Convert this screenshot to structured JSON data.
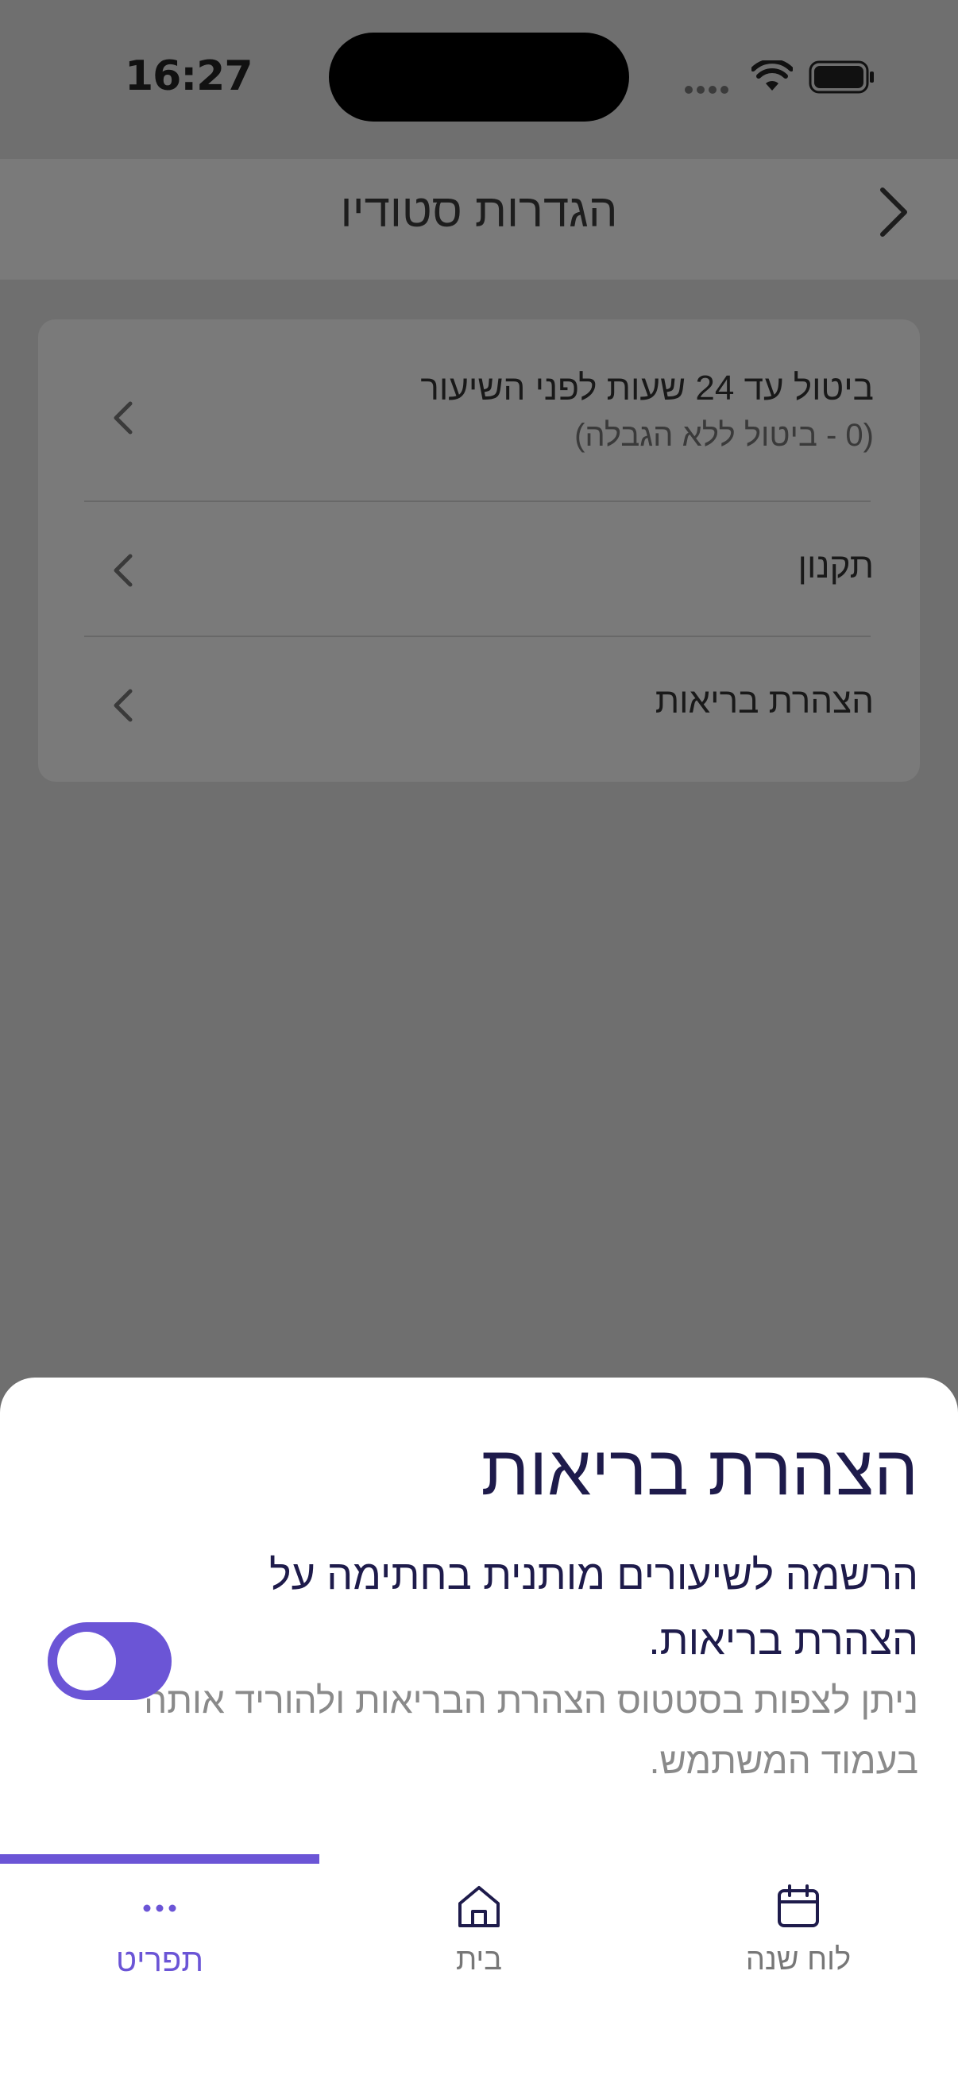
{
  "status_bar": {
    "time": "16:27"
  },
  "header": {
    "title": "הגדרות סטודיו"
  },
  "settings": {
    "items": [
      {
        "title": "ביטול עד 24 שעות לפני השיעור",
        "subtitle": "(0 - ביטול ללא הגבלה)"
      },
      {
        "title": "תקנון"
      },
      {
        "title": "הצהרת בריאות"
      }
    ]
  },
  "sheet": {
    "title": "הצהרת בריאות",
    "description": "הרשמה לשיעורים מותנית בחתימה על הצהרת בריאות.",
    "note": "ניתן לצפות בסטטוס הצהרת הבריאות ולהוריד אותה בעמוד המשתמש.",
    "toggle_on": true
  },
  "tabs": [
    {
      "label": "לוח שנה",
      "icon": "calendar-icon"
    },
    {
      "label": "בית",
      "icon": "home-icon"
    },
    {
      "label": "תפריט",
      "icon": "more-icon",
      "active": true
    }
  ],
  "colors": {
    "accent": "#6b55d6",
    "overlay": "#6f6f6f",
    "title": "#1e1b4b"
  }
}
